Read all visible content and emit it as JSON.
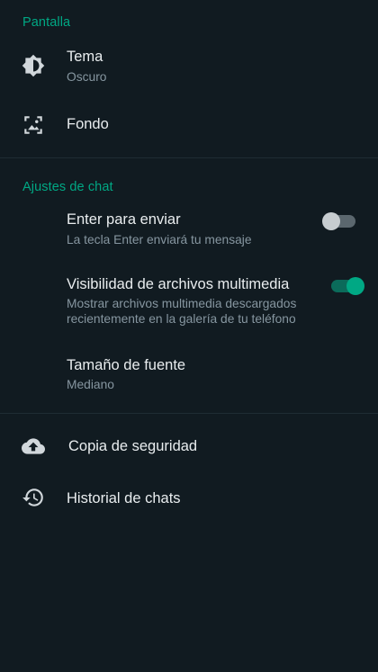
{
  "sections": {
    "display": {
      "header": "Pantalla",
      "theme": {
        "title": "Tema",
        "subtitle": "Oscuro",
        "icon": "brightness-icon"
      },
      "wallpaper": {
        "title": "Fondo",
        "icon": "wallpaper-icon"
      }
    },
    "chat": {
      "header": "Ajustes de chat",
      "enter_send": {
        "title": "Enter para enviar",
        "subtitle": "La tecla Enter enviará tu mensaje",
        "enabled": false
      },
      "media_visibility": {
        "title": "Visibilidad de archivos multimedia",
        "subtitle": "Mostrar archivos multimedia descargados recientemente en la galería de tu teléfono",
        "enabled": true
      },
      "font_size": {
        "title": "Tamaño de fuente",
        "subtitle": "Mediano"
      }
    },
    "other": {
      "backup": {
        "title": "Copia de seguridad",
        "icon": "cloud-upload-icon"
      },
      "history": {
        "title": "Historial de chats",
        "icon": "history-icon"
      }
    }
  },
  "colors": {
    "background": "#111b21",
    "accent": "#00a884",
    "primary_text": "#e9edef",
    "secondary_text": "#8696a0"
  }
}
